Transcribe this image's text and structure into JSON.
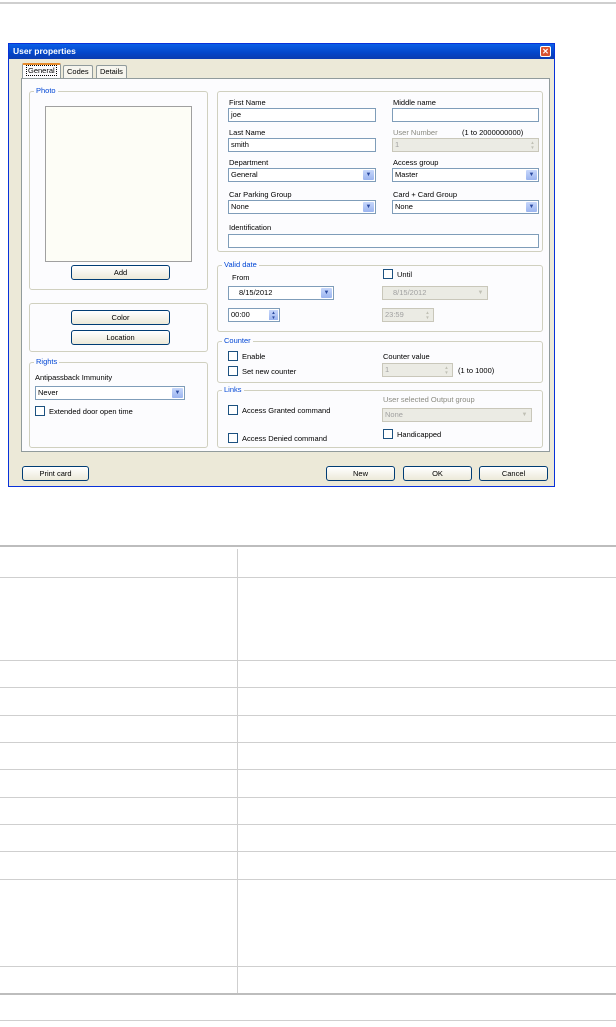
{
  "dialog": {
    "title": "User properties",
    "close_glyph": "✕",
    "tabs": [
      {
        "label": "General",
        "active": true
      },
      {
        "label": "Codes",
        "active": false
      },
      {
        "label": "Details",
        "active": false
      }
    ]
  },
  "photo": {
    "group_title": "Photo",
    "add_label": "Add"
  },
  "actions": {
    "color_label": "Color",
    "location_label": "Location"
  },
  "rights": {
    "group_title": "Rights",
    "antipassback_label": "Antipassback Immunity",
    "antipassback_value": "Never",
    "extended_door_label": "Extended door open time"
  },
  "identity": {
    "first_name_label": "First Name",
    "first_name_value": "joe",
    "middle_name_label": "Middle name",
    "middle_name_value": "",
    "last_name_label": "Last Name",
    "last_name_value": "smith",
    "user_number_label": "User Number",
    "user_number_range": "(1 to 2000000000)",
    "user_number_value": "1",
    "department_label": "Department",
    "department_value": "General",
    "access_group_label": "Access group",
    "access_group_value": "Master",
    "car_parking_label": "Car Parking Group",
    "car_parking_value": "None",
    "card_card_label": "Card + Card Group",
    "card_card_value": "None",
    "identification_label": "Identification",
    "identification_value": ""
  },
  "valid_date": {
    "group_title": "Valid date",
    "from_label": "From",
    "from_date": "8/15/2012",
    "from_time": "00:00",
    "until_label": "Until",
    "until_date": "8/15/2012",
    "until_time": "23:59"
  },
  "counter": {
    "group_title": "Counter",
    "enable_label": "Enable",
    "set_new_label": "Set new counter",
    "value_label": "Counter value",
    "value": "1",
    "range": "(1 to 1000)"
  },
  "links": {
    "group_title": "Links",
    "access_granted_label": "Access Granted command",
    "access_denied_label": "Access Denied command",
    "output_group_label": "User selected Output group",
    "output_group_value": "None",
    "handicapped_label": "Handicapped"
  },
  "footer": {
    "print_card_label": "Print card",
    "new_label": "New",
    "ok_label": "OK",
    "cancel_label": "Cancel"
  },
  "icons": {
    "dropdown_glyph": "▼",
    "spin_up_glyph": "▲",
    "spin_down_glyph": "▼"
  }
}
